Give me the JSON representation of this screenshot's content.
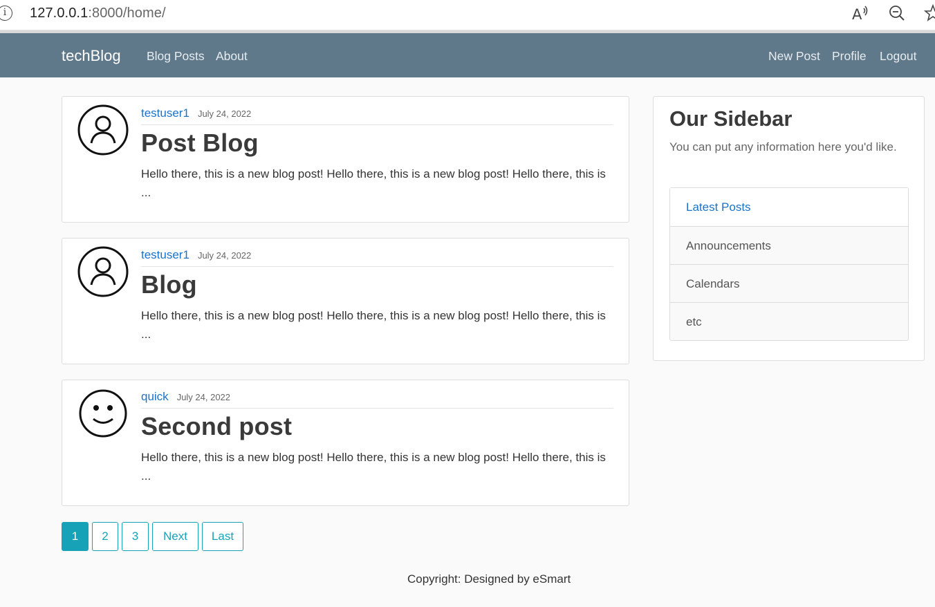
{
  "browser": {
    "url_host": "127.0.0.1",
    "url_path": ":8000/home/",
    "info_icon": "info-icon",
    "toolbar_icons": [
      "read-aloud-icon",
      "zoom-out-icon",
      "favorite-star-icon"
    ]
  },
  "navbar": {
    "brand": "techBlog",
    "left_links": [
      "Blog Posts",
      "About"
    ],
    "right_links": [
      "New Post",
      "Profile",
      "Logout"
    ],
    "background": "#5f788a"
  },
  "posts": [
    {
      "author": "testuser1",
      "date": "July 24, 2022",
      "title": "Post Blog",
      "excerpt": "Hello there, this is a new blog post! Hello there, this is a new blog post! Hello there, this is ...",
      "avatar_icon": "user-outline-icon"
    },
    {
      "author": "testuser1",
      "date": "July 24, 2022",
      "title": "Blog",
      "excerpt": "Hello there, this is a new blog post! Hello there, this is a new blog post! Hello there, this is ...",
      "avatar_icon": "user-outline-icon"
    },
    {
      "author": "quick",
      "date": "July 24, 2022",
      "title": "Second post",
      "excerpt": "Hello there, this is a new blog post! Hello there, this is a new blog post! Hello there, this is ...",
      "avatar_icon": "smiley-face-icon"
    }
  ],
  "sidebar": {
    "title": "Our Sidebar",
    "description": "You can put any information here you'd like.",
    "items": [
      "Latest Posts",
      "Announcements",
      "Calendars",
      "etc"
    ]
  },
  "pagination": {
    "pages": [
      "1",
      "2",
      "3",
      "Next",
      "Last"
    ],
    "current": "1",
    "accent": "#17a2b8"
  },
  "footer": {
    "text": "Copyright: Designed by eSmart"
  },
  "colors": {
    "link": "#1a73c9"
  }
}
